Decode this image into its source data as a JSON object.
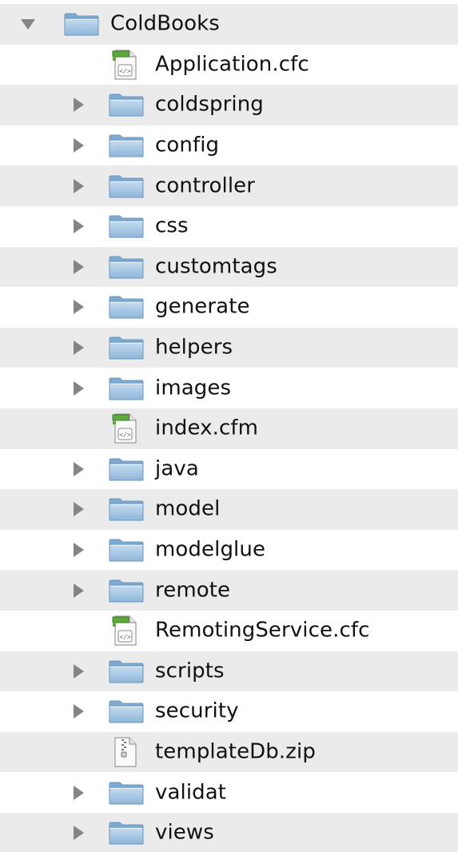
{
  "tree": {
    "root": {
      "label": "ColdBooks",
      "type": "folder",
      "expanded": true
    },
    "children": [
      {
        "label": "Application.cfc",
        "type": "code-file"
      },
      {
        "label": "coldspring",
        "type": "folder"
      },
      {
        "label": "config",
        "type": "folder"
      },
      {
        "label": "controller",
        "type": "folder"
      },
      {
        "label": "css",
        "type": "folder"
      },
      {
        "label": "customtags",
        "type": "folder"
      },
      {
        "label": "generate",
        "type": "folder"
      },
      {
        "label": "helpers",
        "type": "folder"
      },
      {
        "label": "images",
        "type": "folder"
      },
      {
        "label": "index.cfm",
        "type": "code-file"
      },
      {
        "label": "java",
        "type": "folder"
      },
      {
        "label": "model",
        "type": "folder"
      },
      {
        "label": "modelglue",
        "type": "folder"
      },
      {
        "label": "remote",
        "type": "folder"
      },
      {
        "label": "RemotingService.cfc",
        "type": "code-file"
      },
      {
        "label": "scripts",
        "type": "folder"
      },
      {
        "label": "security",
        "type": "folder"
      },
      {
        "label": "templateDb.zip",
        "type": "zip-file"
      },
      {
        "label": "validat",
        "type": "folder"
      },
      {
        "label": "views",
        "type": "folder"
      }
    ]
  },
  "colors": {
    "alt_row": "#ebebeb",
    "folder_body": "#a9cbe6",
    "disclosure": "#858585"
  },
  "icons": {
    "folder": "folder-icon",
    "code-file": "code-file-icon",
    "zip-file": "zip-file-icon",
    "collapsed": "disclosure-closed-icon",
    "expanded": "disclosure-open-icon"
  }
}
